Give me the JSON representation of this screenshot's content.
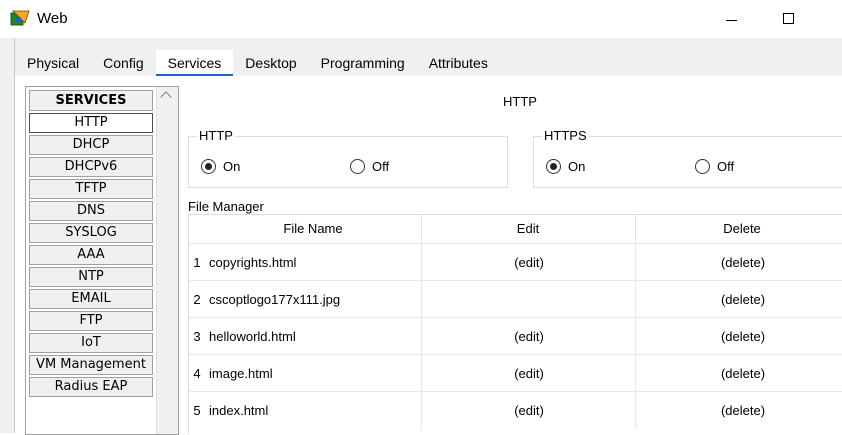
{
  "window": {
    "title": "Web"
  },
  "tabs": [
    "Physical",
    "Config",
    "Services",
    "Desktop",
    "Programming",
    "Attributes"
  ],
  "active_tab": "Services",
  "services": {
    "header": "SERVICES",
    "items": [
      "HTTP",
      "DHCP",
      "DHCPv6",
      "TFTP",
      "DNS",
      "SYSLOG",
      "AAA",
      "NTP",
      "EMAIL",
      "FTP",
      "IoT",
      "VM Management",
      "Radius EAP"
    ],
    "selected": "HTTP"
  },
  "main": {
    "title": "HTTP",
    "http_group": {
      "label": "HTTP",
      "on_label": "On",
      "off_label": "Off",
      "selected": "On"
    },
    "https_group": {
      "label": "HTTPS",
      "on_label": "On",
      "off_label": "Off",
      "selected": "On"
    },
    "file_manager": {
      "label": "File Manager",
      "columns": [
        "File Name",
        "Edit",
        "Delete"
      ],
      "rows": [
        {
          "num": "1",
          "name": "copyrights.html",
          "edit": "(edit)",
          "delete": "(delete)"
        },
        {
          "num": "2",
          "name": "cscoptlogo177x111.jpg",
          "edit": "",
          "delete": "(delete)"
        },
        {
          "num": "3",
          "name": "helloworld.html",
          "edit": "(edit)",
          "delete": "(delete)"
        },
        {
          "num": "4",
          "name": "image.html",
          "edit": "(edit)",
          "delete": "(delete)"
        },
        {
          "num": "5",
          "name": "index.html",
          "edit": "(edit)",
          "delete": "(delete)"
        }
      ]
    }
  }
}
